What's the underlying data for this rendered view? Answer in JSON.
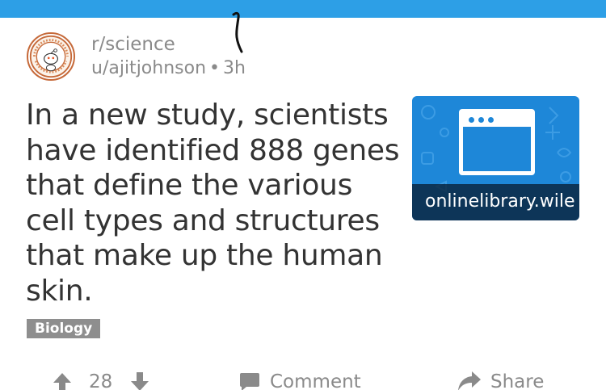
{
  "post": {
    "subreddit_prefix": "r/",
    "subreddit_name": "science",
    "author": "u/ajitjohnson",
    "separator": "•",
    "age": "3h",
    "title": "In a new study, scientists have identified 888 genes that define the various cell types and structures that make up the human skin.",
    "flair": "Biology",
    "thumbnail": {
      "domain": "onlinelibrary.wile",
      "icon": "browser-window-icon"
    }
  },
  "actions": {
    "score": "28",
    "upvote_icon": "arrow-up-icon",
    "downvote_icon": "arrow-down-icon",
    "comment_label": "Comment",
    "comment_icon": "speech-bubble-icon",
    "share_label": "Share",
    "share_icon": "share-arrow-icon"
  },
  "colors": {
    "top_bar": "#2d9fe6",
    "thumbnail_bg": "#1e87d8",
    "flair_bg": "#8e8e8e",
    "meta_text": "#8a8a8a",
    "title_text": "#333333"
  }
}
